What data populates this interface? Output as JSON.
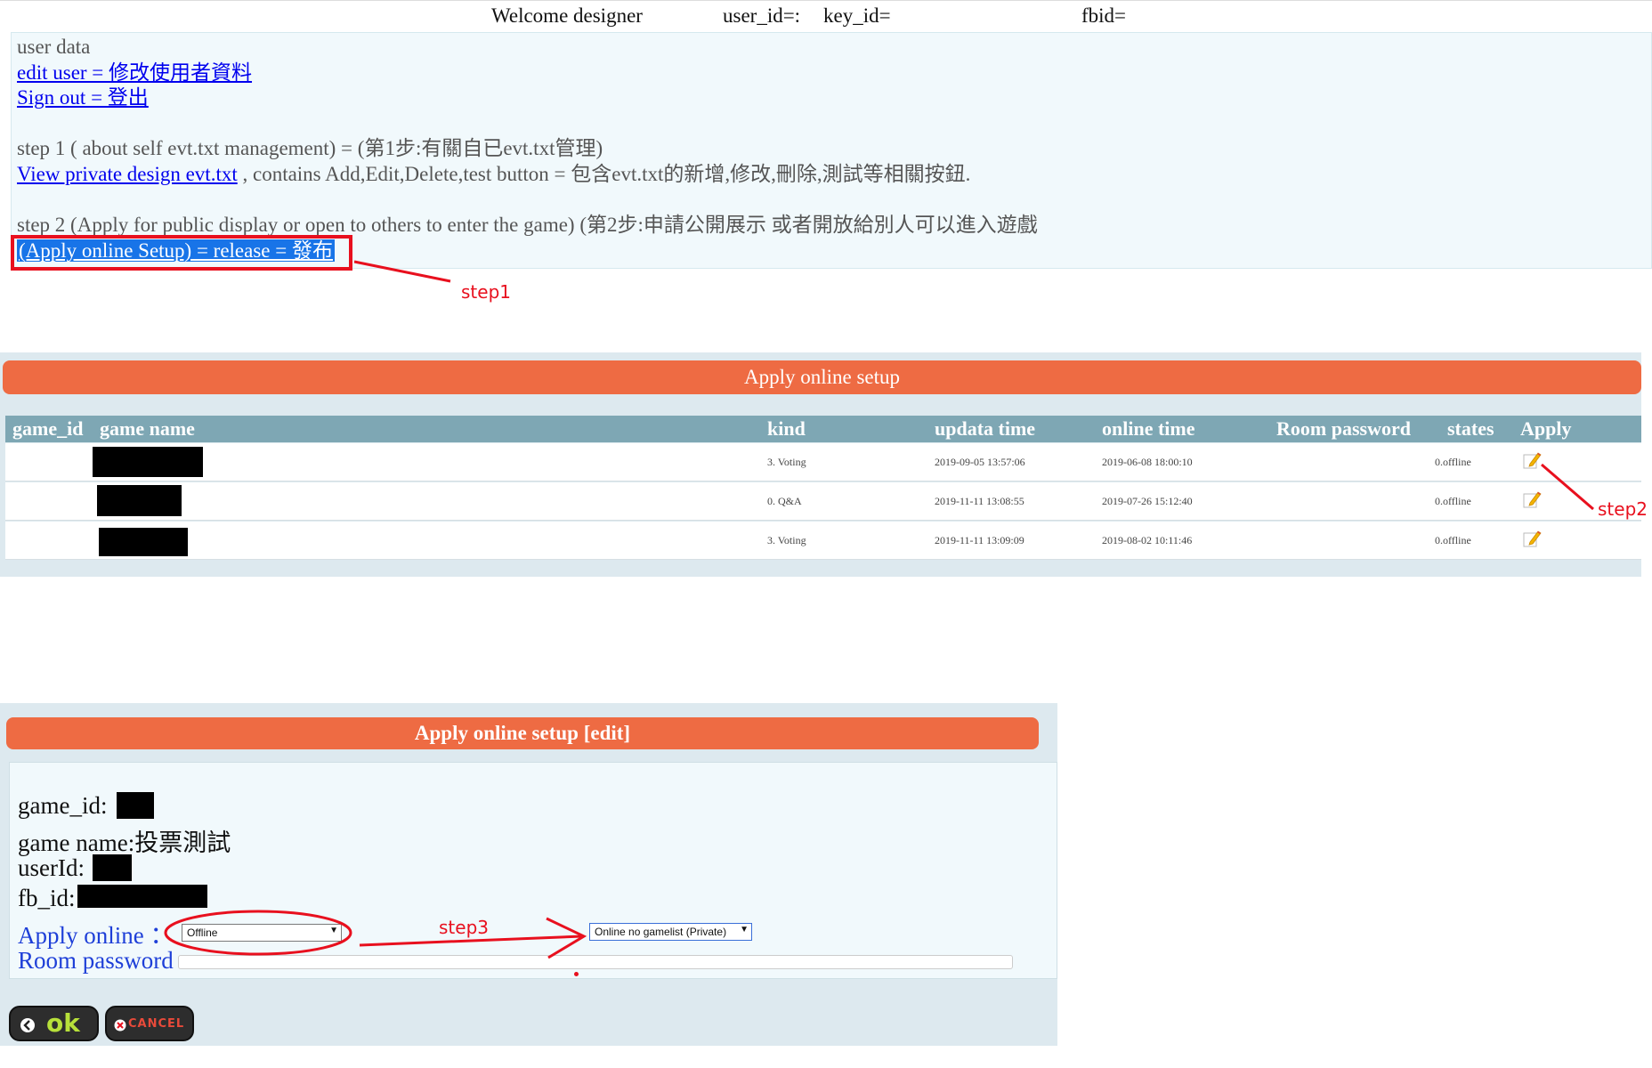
{
  "header": {
    "welcome": "Welcome designer",
    "user_id": "user_id=:",
    "key_id": "key_id=",
    "fbid": "fbid="
  },
  "user_panel": {
    "user_data": "user data",
    "edit_user": "edit user = 修改使用者資料",
    "sign_out": "Sign out = 登出",
    "step1": "step 1 ( about self evt.txt management) = (第1步:有關自已evt.txt管理)",
    "view_private": "View private design evt.txt",
    "view_private_suffix": " , contains Add,Edit,Delete,test button = 包含evt.txt的新增,修改,刪除,測試等相關按鈕.",
    "step2": "step 2 (Apply for public display or open to others to enter the game) (第2步:申請公開展示 或者開放給別人可以進入遊戲",
    "apply_link": "(Apply online Setup) = release = 發布"
  },
  "annotations": {
    "step1": "step1",
    "step2": "step2",
    "step3": "step3"
  },
  "list": {
    "title": "Apply online setup",
    "columns": [
      "game_id",
      "game name",
      "kind",
      "updata time",
      "online time",
      "Room password",
      "states",
      "Apply"
    ],
    "rows": [
      {
        "kind": "3. Voting",
        "updata_time": "2019-09-05 13:57:06",
        "online_time": "2019-06-08 18:00:10",
        "room_password": "",
        "states": "0.offline"
      },
      {
        "kind": "0. Q&A",
        "updata_time": "2019-11-11 13:08:55",
        "online_time": "2019-07-26 15:12:40",
        "room_password": "",
        "states": "0.offline"
      },
      {
        "kind": "3. Voting",
        "updata_time": "2019-11-11 13:09:09",
        "online_time": "2019-08-02 10:11:46",
        "room_password": "",
        "states": "0.offline"
      }
    ]
  },
  "edit": {
    "title": "Apply online setup [edit]",
    "game_id_label": "game_id:",
    "game_name_label": "game name:",
    "game_name_value": "投票測試",
    "user_id_label": "userId:",
    "fb_id_label": "fb_id:",
    "apply_online_label": "Apply online ：",
    "apply_online_value": "Offline",
    "apply_online_alt_value": "Online no gamelist (Private)",
    "room_password_label": "Room password",
    "room_password_value": "",
    "ok_label": "ok",
    "cancel_label": "CANCEL"
  },
  "colors": {
    "accent_orange": "#ee6b43",
    "table_header": "#7ea7b4",
    "annotation_red": "#e8101e",
    "link_blue": "#0000ee"
  }
}
